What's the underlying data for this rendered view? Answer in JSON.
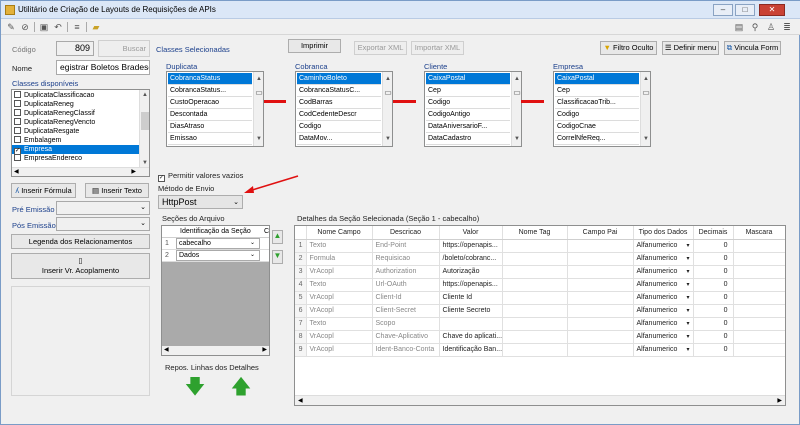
{
  "window": {
    "title": "Utilitário de Criação de Layouts de Requisições de APIs"
  },
  "form": {
    "codigo_label": "Código",
    "codigo_value": "809",
    "buscar_label": "Buscar",
    "nome_label": "Nome",
    "nome_value": "egistrar Boletos Bradesco",
    "classes_disponiveis_label": "Classes disponíveis",
    "classes_disponiveis": [
      {
        "label": "DuplicataClassificacao",
        "checked": false,
        "selected": false
      },
      {
        "label": "DuplicataReneg",
        "checked": false,
        "selected": false
      },
      {
        "label": "DuplicataRenegClassif",
        "checked": false,
        "selected": false
      },
      {
        "label": "DuplicataRenegVencto",
        "checked": false,
        "selected": false
      },
      {
        "label": "DuplicataResgate",
        "checked": false,
        "selected": false
      },
      {
        "label": "Embalagem",
        "checked": false,
        "selected": false
      },
      {
        "label": "Empresa",
        "checked": true,
        "selected": true
      },
      {
        "label": "EmpresaEndereco",
        "checked": false,
        "selected": false
      }
    ],
    "inserir_formula": "Inserir Fórmula",
    "inserir_texto": "Inserir Texto",
    "pre_emissao": "Pré Emissão",
    "pos_emissao": "Pós Emissão",
    "legenda": "Legenda dos Relacionamentos",
    "inserir_vr_acoplamento": "Inserir Vr. Acoplamento"
  },
  "top_buttons": {
    "imprimir": "Imprimir",
    "exportar_xml": "Exportar XML",
    "importar_xml": "Importar XML",
    "filtro_oculto": "Filtro Oculto",
    "definir_menu": "Definir menu",
    "vincula_form": "Vincula Form"
  },
  "classes_selecionadas_label": "Classes Selecionadas",
  "class_tables": [
    {
      "title": "Duplicata",
      "fields": [
        "CobrancaStatus",
        "CobrancaStatus...",
        "CustoOperacao",
        "Descontada",
        "DiasAtraso",
        "Emissao"
      ]
    },
    {
      "title": "Cobranca",
      "fields": [
        "CaminhoBoleto",
        "CobrancaStatusC...",
        "CodBarras",
        "CodCedenteDescr",
        "Codigo",
        "DataMov..."
      ]
    },
    {
      "title": "Cliente",
      "fields": [
        "CaixaPostal",
        "Cep",
        "Codigo",
        "CodigoAntigo",
        "DataAniversarioF...",
        "DataCadastro"
      ]
    },
    {
      "title": "Empresa",
      "fields": [
        "CaixaPostal",
        "Cep",
        "ClassificacaoTrib...",
        "Codigo",
        "CodigoCnae",
        "CorrelNfeReq..."
      ]
    }
  ],
  "permitir_vazios": "Permitir valores vazios",
  "metodo_envio_label": "Método de Envio",
  "metodo_envio_value": "HttpPost",
  "secoes": {
    "label": "Seções do Arquivo",
    "header": "Identificação da Seção",
    "header_c": "C",
    "rows": [
      {
        "num": "1",
        "value": "cabecalho"
      },
      {
        "num": "2",
        "value": "Dados"
      }
    ]
  },
  "repos_label": "Repos. Linhas dos Detalhes",
  "detalhes": {
    "label": "Detalhes da Seção Selecionada (Seção 1 - cabecalho)",
    "columns": [
      "Nome Campo",
      "Descricao",
      "Valor",
      "Nome Tag",
      "Campo Pai",
      "Tipo dos Dados",
      "Decimais",
      "Mascara"
    ],
    "rows": [
      [
        "1",
        "Texto",
        "End-Point",
        "https://openapis...",
        "",
        "",
        "Alfanumerico",
        "0"
      ],
      [
        "2",
        "Formula",
        "Requisicao",
        "/boleto/cobranc...",
        "",
        "",
        "Alfanumerico",
        "0"
      ],
      [
        "3",
        "VrAcopl",
        "Authorization",
        "Autorização",
        "",
        "",
        "Alfanumerico",
        "0"
      ],
      [
        "4",
        "Texto",
        "Url-OAuth",
        "https://openapis...",
        "",
        "",
        "Alfanumerico",
        "0"
      ],
      [
        "5",
        "VrAcopl",
        "Client-Id",
        "Cliente Id",
        "",
        "",
        "Alfanumerico",
        "0"
      ],
      [
        "6",
        "VrAcopl",
        "Client-Secret",
        "Cliente Secreto",
        "",
        "",
        "Alfanumerico",
        "0"
      ],
      [
        "7",
        "Texto",
        "Scopo",
        "",
        "",
        "",
        "Alfanumerico",
        "0"
      ],
      [
        "8",
        "VrAcopl",
        "Chave-Aplicativo",
        "Chave do aplicati...",
        "",
        "",
        "Alfanumerico",
        "0"
      ],
      [
        "9",
        "VrAcopl",
        "Ident-Banco-Conta",
        "Identificação Ban...",
        "",
        "",
        "Alfanumerico",
        "0"
      ]
    ]
  },
  "colors": {
    "accent": "#0078d7",
    "relation_line": "#e01010",
    "arrow_green": "#2ea12e"
  }
}
